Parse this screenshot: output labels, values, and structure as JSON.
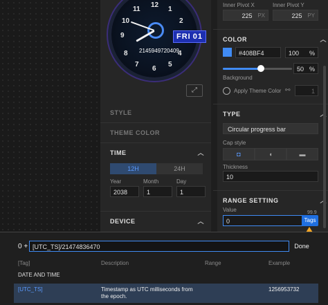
{
  "watch": {
    "numbers": [
      "12",
      "1",
      "2",
      "3",
      "4",
      "5",
      "6",
      "7",
      "8",
      "9",
      "10",
      "11"
    ],
    "date_day": "FRI",
    "date_num": "01",
    "epoch_text": "2145949720409"
  },
  "icons": {
    "expand": "expand-icon",
    "link": "link-icon",
    "cap_icons": [
      "cap-square-icon",
      "cap-round-icon",
      "cap-flat-icon"
    ]
  },
  "left_panel": {
    "style_label": "STYLE",
    "theme_color_label": "THEME COLOR",
    "time": {
      "label": "TIME",
      "mode_12h": "12H",
      "mode_24h": "24H",
      "year_label": "Year",
      "month_label": "Month",
      "day_label": "Day",
      "year": "2038",
      "month": "1",
      "day": "1"
    },
    "device_label": "DEVICE"
  },
  "right_panel": {
    "pivot_x_label": "Inner Pivot X",
    "pivot_y_label": "Inner Pivot Y",
    "pivot_x": "225",
    "pivot_y": "225",
    "px_unit": "PX",
    "py_unit": "PY",
    "color": {
      "label": "COLOR",
      "hex": "#408BF4",
      "opacity": "100",
      "percent": "%",
      "slider_value": "50",
      "slider_fraction": 0.5,
      "background_label": "Background",
      "apply_theme_label": "Apply Theme Color",
      "theme_num": "1",
      "swatch": "#408BF4"
    },
    "type": {
      "label": "TYPE",
      "selected": "Circular progress bar",
      "cap_label": "Cap style",
      "thickness_label": "Thickness",
      "thickness": "10"
    },
    "range": {
      "label": "RANGE SETTING",
      "value_label": "Value",
      "max_hint": "99.9",
      "value": "0",
      "tags_label": "Tags"
    }
  },
  "modal": {
    "prefix": "0 +",
    "expression": "[UTC_TS]/21474836470",
    "done_label": "Done",
    "col_tag": "[Tag]",
    "col_desc": "Description",
    "col_range": "Range",
    "col_example": "Example",
    "group": "DATE AND TIME",
    "rows": [
      {
        "tag": "[UTC_TS]",
        "description": "Timestamp as UTC milliseconds from the epoch.",
        "example": "1256953732"
      }
    ]
  }
}
